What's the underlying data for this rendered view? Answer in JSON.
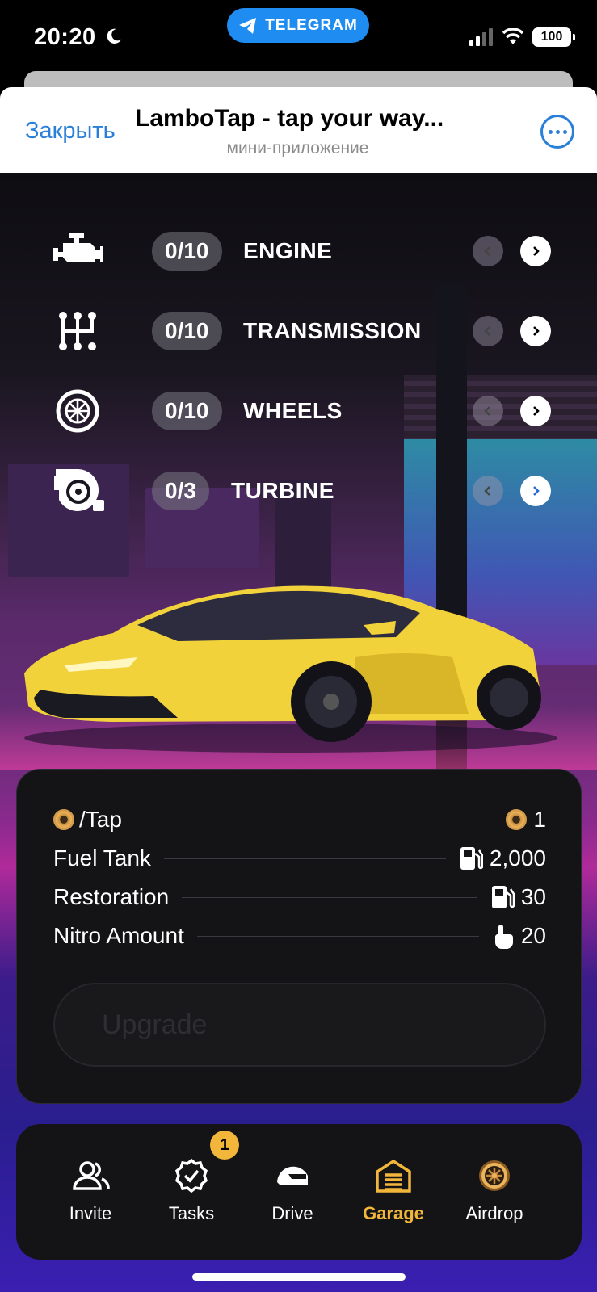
{
  "status_bar": {
    "time": "20:20",
    "telegram_label": "TELEGRAM",
    "battery": "100"
  },
  "header": {
    "close_label": "Закрыть",
    "title": "LamboTap - tap your way...",
    "subtitle": "мини-приложение"
  },
  "parts": [
    {
      "icon": "engine-icon",
      "level": "0/10",
      "name": "ENGINE"
    },
    {
      "icon": "gearshift-icon",
      "level": "0/10",
      "name": "TRANSMISSION"
    },
    {
      "icon": "wheel-icon",
      "level": "0/10",
      "name": "WHEELS"
    },
    {
      "icon": "turbine-icon",
      "level": "0/3",
      "name": "TURBINE"
    }
  ],
  "stats": {
    "tap": {
      "label": "/Tap",
      "value": "1",
      "icon": "coin-icon"
    },
    "fuel_tank": {
      "label": "Fuel Tank",
      "value": "2,000",
      "icon": "fuel-pump-icon"
    },
    "restoration": {
      "label": "Restoration",
      "value": "30",
      "icon": "fuel-pump-icon"
    },
    "nitro": {
      "label": "Nitro Amount",
      "value": "20",
      "icon": "tap-hand-icon"
    }
  },
  "upgrade_label": "Upgrade",
  "nav": {
    "items": [
      {
        "label": "Invite",
        "icon": "people-icon"
      },
      {
        "label": "Tasks",
        "icon": "check-badge-icon",
        "badge": "1"
      },
      {
        "label": "Drive",
        "icon": "helmet-icon"
      },
      {
        "label": "Garage",
        "icon": "garage-icon",
        "active": true
      },
      {
        "label": "Airdrop",
        "icon": "coin-icon"
      }
    ]
  },
  "colors": {
    "accent": "#f2b73a",
    "link": "#2a7fd8",
    "telegram": "#1e8cf0",
    "card": "#141416"
  }
}
